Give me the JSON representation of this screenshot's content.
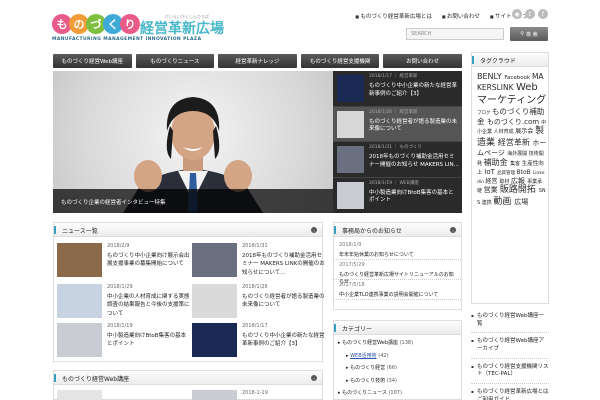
{
  "header": {
    "logo_chars": [
      "も",
      "の",
      "づ",
      "く",
      "り"
    ],
    "logo_colors": [
      "#e95b88",
      "#f29c38",
      "#7fbf3f",
      "#3fa9d8",
      "#e95b88"
    ],
    "logo_side": "経営革新広場",
    "logo_ruby": "けいえいかくしんひろば",
    "logo_sub": "MANUFACTURING MANAGEMENT INNOVATION PLAZA",
    "top_links": [
      "ものづくり経営革新広場とは",
      "お問い合わせ",
      "サイトマップ"
    ],
    "social_icons": [
      "rss-icon",
      "twitter-icon",
      "facebook-icon"
    ],
    "search_placeholder": "SEARCH",
    "search_button": "検 索"
  },
  "nav": [
    "ものづくり経営Web講座",
    "ものづくりニュース",
    "経営革新ナレッジ",
    "ものづくり経営支援機関",
    "お問い合わせ"
  ],
  "slider": {
    "caption": "ものづくり企業の経営者インタビュー特集",
    "items": [
      {
        "date": "2018/1/17",
        "cat": "経営革新",
        "title": "ものづくり中小企業の新たな経営革新事例のご紹介【3】"
      },
      {
        "date": "2018/1/26",
        "cat": "経営革新",
        "title": "ものづくり経営者が語る製造業の未来像について"
      },
      {
        "date": "2018/1/31",
        "cat": "ものづくり",
        "title": "2018年ものづくり補助金活用セミナー開催のお知らせ MAKERS LIN..."
      },
      {
        "date": "2018/1/19",
        "cat": "WEB講座",
        "title": "中小製造業向けBtoB集客の基本とポイント"
      }
    ]
  },
  "news": {
    "title": "ニュース一覧",
    "items": [
      {
        "date": "2018/2/9",
        "title": "ものづくり中小企業向け展示会出展支援事業の募集開始について"
      },
      {
        "date": "2018/1/31",
        "title": "2018年ものづくり補助金活用セミナー MAKERS LINKの開催のお知らせについて..."
      },
      {
        "date": "2018/1/29",
        "title": "中小企業の人材育成に関する実態調査の結果報告と今後の支援策について"
      },
      {
        "date": "2018/1/26",
        "title": "ものづくり経営者が語る製造業の未来像について"
      },
      {
        "date": "2018/1/19",
        "title": "中小製造業向けBtoB集客の基本とポイント"
      },
      {
        "date": "2018/1/17",
        "title": "ものづくり中小企業の新たな経営革新事例のご紹介【3】"
      }
    ]
  },
  "notice": {
    "title": "事務局からのお知らせ",
    "items": [
      {
        "date": "2018/1/9",
        "title": "年末年始休業のお知らせについて"
      },
      {
        "date": "2017/5/29",
        "title": "ものづくり経営革新広場サイトリニューアルのお知らせ"
      },
      {
        "date": "2017/5/18",
        "title": "中小企業TLO連携事業の説明会開催について"
      }
    ]
  },
  "category": {
    "title": "カテゴリー",
    "items": [
      {
        "label": "ものづくり経営Web講座",
        "count": "(138)"
      },
      {
        "label": "WEB活用術",
        "count": "(42)"
      },
      {
        "label": "ものづくり経営",
        "count": "(66)"
      },
      {
        "label": "ものづくり技術",
        "count": "(34)"
      },
      {
        "label": "ものづくりニュース",
        "count": "(107)"
      }
    ]
  },
  "webcourse": {
    "title": "ものづくり経営Web講座",
    "date": "2018-1-19"
  },
  "tagcloud": {
    "title": "タグクラウド",
    "tags": [
      {
        "t": "BENLY",
        "s": 8
      },
      {
        "t": "Facebook",
        "s": 5.5
      },
      {
        "t": "MAKERSLINK",
        "s": 7.5
      },
      {
        "t": "Webマーケティング",
        "s": 10
      },
      {
        "t": "ブログ",
        "s": 4.5
      },
      {
        "t": "ものづくり補助金",
        "s": 7.5
      },
      {
        "t": "ものづくり.com",
        "s": 7
      },
      {
        "t": "中小企業",
        "s": 5
      },
      {
        "t": "人材育成",
        "s": 5
      },
      {
        "t": "展示会",
        "s": 6
      },
      {
        "t": "製造業",
        "s": 9
      },
      {
        "t": "経営革新",
        "s": 8
      },
      {
        "t": "ホームページ",
        "s": 7
      },
      {
        "t": "海外展開",
        "s": 5
      },
      {
        "t": "技術開発",
        "s": 5
      },
      {
        "t": "補助金",
        "s": 8
      },
      {
        "t": "集客",
        "s": 5
      },
      {
        "t": "生産性向上",
        "s": 5.5
      },
      {
        "t": "IoT",
        "s": 7
      },
      {
        "t": "品質管理",
        "s": 4.5
      },
      {
        "t": "BtoB",
        "s": 6
      },
      {
        "t": "Linkedin",
        "s": 4.5
      },
      {
        "t": "経営",
        "s": 6
      },
      {
        "t": "取材",
        "s": 5
      },
      {
        "t": "広報",
        "s": 7
      },
      {
        "t": "事業承継",
        "s": 5
      },
      {
        "t": "営業",
        "s": 7
      },
      {
        "t": "販路開拓",
        "s": 9
      },
      {
        "t": "SNS",
        "s": 5
      },
      {
        "t": "連携",
        "s": 5
      },
      {
        "t": "動画",
        "s": 9
      },
      {
        "t": "広場",
        "s": 7
      }
    ]
  },
  "right_links": [
    "ものづくり経営Web講座一覧",
    "ものづくり経営Web講座アーカイブ",
    "ものづくり経営支援機関リスト（TEC-PAL）",
    "ものづくり経営革新広場とは ご利用ガイド"
  ]
}
